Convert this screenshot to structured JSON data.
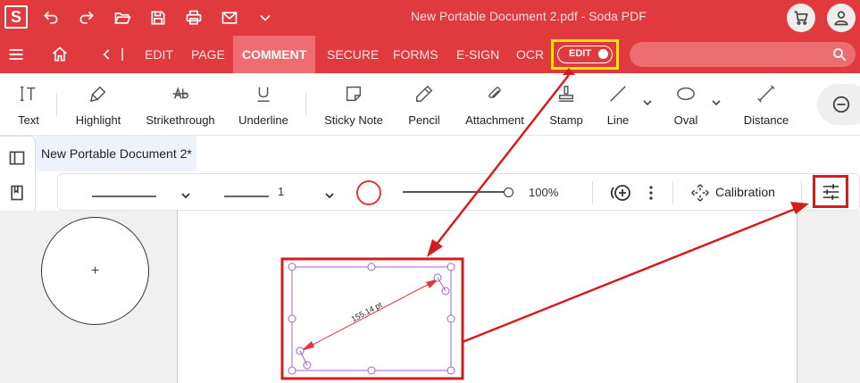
{
  "app": {
    "logo": "S",
    "title": "New Portable Document 2.pdf  -  Soda PDF"
  },
  "menu": {
    "items": [
      "EDIT",
      "PAGE",
      "COMMENT",
      "SECURE",
      "FORMS",
      "E-SIGN",
      "OCR"
    ],
    "active": "COMMENT",
    "edit_toggle_label": "EDIT"
  },
  "tools": [
    {
      "label": "Text",
      "icon": "text-tool-icon"
    },
    {
      "label": "Highlight",
      "icon": "highlighter-icon"
    },
    {
      "label": "Strikethrough",
      "icon": "strikethrough-icon"
    },
    {
      "label": "Underline",
      "icon": "underline-icon"
    },
    {
      "label": "Sticky Note",
      "icon": "sticky-note-icon"
    },
    {
      "label": "Pencil",
      "icon": "pencil-icon"
    },
    {
      "label": "Attachment",
      "icon": "paperclip-icon"
    },
    {
      "label": "Stamp",
      "icon": "stamp-icon"
    },
    {
      "label": "Line",
      "icon": "line-icon"
    },
    {
      "label": "Oval",
      "icon": "oval-icon"
    },
    {
      "label": "Distance",
      "icon": "distance-icon"
    }
  ],
  "document": {
    "tab_label": "New Portable Document 2*",
    "measurement_label": "155.14 pt"
  },
  "properties": {
    "line_width": "1",
    "opacity": "100%",
    "opacity_value": 1.0,
    "calibration_label": "Calibration",
    "stroke_color": "#e0393e"
  },
  "colors": {
    "brand": "#e0393e",
    "annotation_red": "#d61d1d",
    "highlight_yellow": "#f1e800",
    "selection_purple": "#a064c8"
  }
}
